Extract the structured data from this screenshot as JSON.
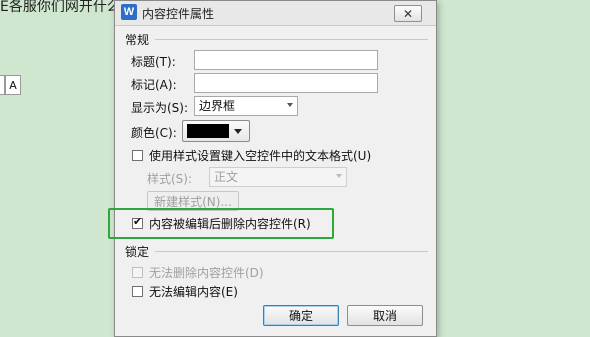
{
  "background_doc": {
    "top_text": "E各服你们网开什么",
    "box_label": "A"
  },
  "dialog": {
    "app_icon": "W",
    "title": "内容控件属性",
    "close_icon": "close-x-icon",
    "close_glyph": "✕",
    "general_group": "常规",
    "title_label": "标题(T):",
    "title_value": "",
    "tag_label": "标记(A):",
    "tag_value": "",
    "show_as_label": "显示为(S):",
    "show_as_value": "边界框",
    "color_label": "颜色(C):",
    "color_value": "#000000",
    "use_style_label": "使用样式设置键入空控件中的文本格式(U)",
    "use_style_checked": false,
    "style_label": "样式(S):",
    "style_value": "正文",
    "new_style_label": "新建样式(N)...",
    "remove_label": "内容被编辑后删除内容控件(R)",
    "remove_checked": true,
    "lock_group": "锁定",
    "cannot_delete_label": "无法删除内容控件(D)",
    "cannot_delete_checked": false,
    "cannot_edit_label": "无法编辑内容(E)",
    "cannot_edit_checked": false,
    "ok_label": "确定",
    "cancel_label": "取消"
  },
  "colors": {
    "highlight": "#2fa83b",
    "background": "#cfe6cf"
  }
}
